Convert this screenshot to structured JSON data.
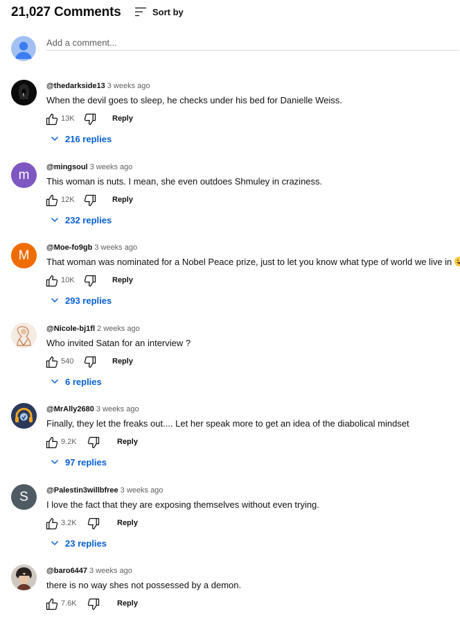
{
  "header": {
    "count": "21,027 Comments",
    "sort_label": "Sort by"
  },
  "add_comment": {
    "placeholder": "Add a comment..."
  },
  "comments": [
    {
      "author": "@thedarkside13",
      "time": "3 weeks ago",
      "text": "When the devil goes to sleep, he checks under his bed for Danielle Weiss.",
      "likes": "13K",
      "reply": "Reply",
      "replies": "216 replies",
      "avatar": "dark-hooded-figure",
      "avatar_color": "#111111"
    },
    {
      "author": "@mingsoul",
      "time": "3 weeks ago",
      "text": "This woman is nuts. I mean, she even outdoes Shmuley in craziness.",
      "likes": "12K",
      "reply": "Reply",
      "replies": "232 replies",
      "avatar_letter": "m",
      "avatar_color": "#7e57c2"
    },
    {
      "author": "@Moe-fo9gb",
      "time": "3 weeks ago",
      "text": "That woman was nominated for a Nobel Peace prize, just to let you know what type of world we live in",
      "emoji": "grinning-sweat-face",
      "likes": "10K",
      "reply": "Reply",
      "replies": "293 replies",
      "avatar_letter": "M",
      "avatar_color": "#ef6c00"
    },
    {
      "author": "@Nicole-bj1fl",
      "time": "2 weeks ago",
      "text": "Who invited Satan for an interview ?",
      "likes": "540",
      "reply": "Reply",
      "replies": "6 replies",
      "avatar": "sketched-figure",
      "avatar_color": "#f1e6dc"
    },
    {
      "author": "@MrAlly2680",
      "time": "3 weeks ago",
      "text": "Finally, they let the freaks out.... Let her speak more to get an idea of the diabolical mindset",
      "likes": "9.2K",
      "reply": "Reply",
      "replies": "97 replies",
      "avatar": "headphones-logo",
      "avatar_color": "#2a3550"
    },
    {
      "author": "@Palestin3willbfree",
      "time": "3 weeks ago",
      "text": "I love the fact that they are exposing themselves without even trying.",
      "likes": "3.2K",
      "reply": "Reply",
      "replies": "23 replies",
      "avatar_letter": "S",
      "avatar_color": "#4e5b62"
    },
    {
      "author": "@baro6447",
      "time": "3 weeks ago",
      "text": "there is no way shes not possessed by a demon.",
      "likes": "7.6K",
      "reply": "Reply",
      "avatar": "anime-character",
      "avatar_color": "#c9c2bb"
    }
  ],
  "colors": {
    "link_blue": "#065fd4",
    "secondary_text": "#606060"
  }
}
